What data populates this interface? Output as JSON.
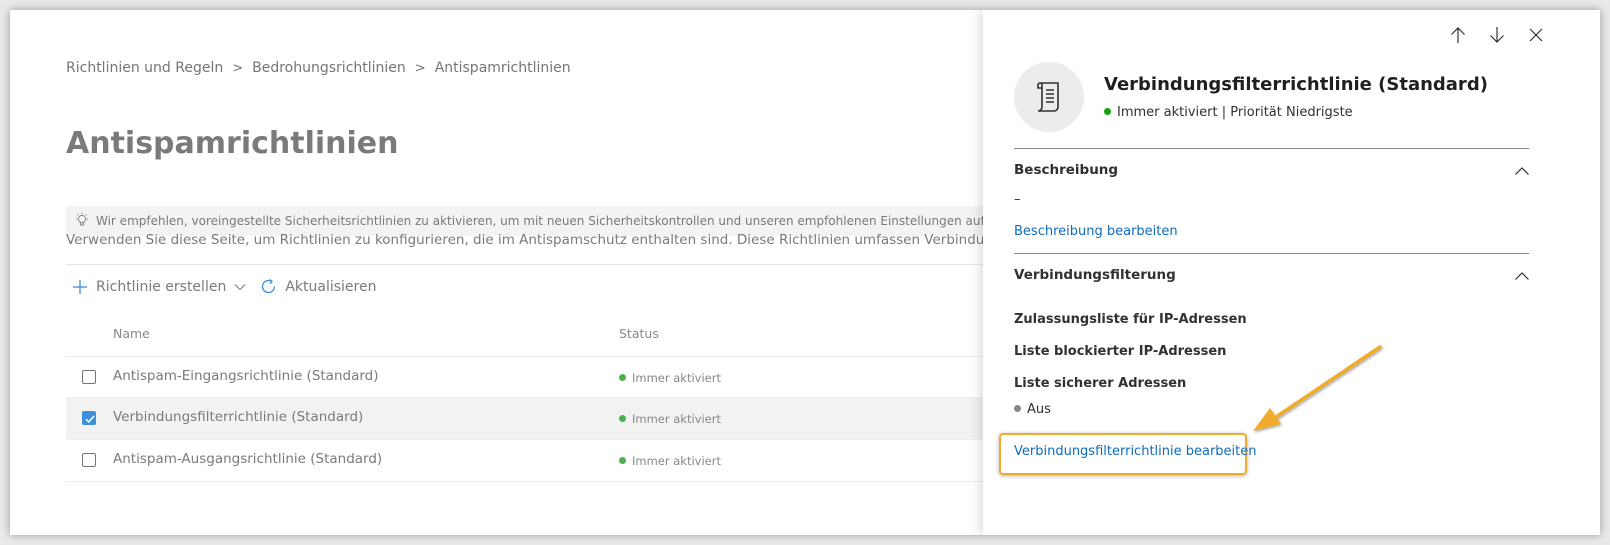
{
  "breadcrumb": {
    "items": [
      "Richtlinien und Regeln",
      "Bedrohungsrichtlinien",
      "Antispamrichtlinien"
    ],
    "separator": ">"
  },
  "page": {
    "title": "Antispamrichtlinien",
    "recommendation": "Wir empfehlen, voreingestellte Sicherheitsrichtlinien zu aktivieren, um mit neuen Sicherheitskontrollen und unseren empfohlenen Einstellungen auf dem Laufenden zu bleiben",
    "description": "Verwenden Sie diese Seite, um Richtlinien zu konfigurieren, die im Antispamschutz enthalten sind. Diese Richtlinien umfassen Verbindungsfilterung, Spamf"
  },
  "toolbar": {
    "create_label": "Richtlinie erstellen",
    "refresh_label": "Aktualisieren"
  },
  "table": {
    "columns": {
      "name": "Name",
      "status": "Status"
    },
    "rows": [
      {
        "name": "Antispam-Eingangsrichtlinie (Standard)",
        "status": "Immer aktiviert",
        "selected": false
      },
      {
        "name": "Verbindungsfilterrichtlinie (Standard)",
        "status": "Immer aktiviert",
        "selected": true
      },
      {
        "name": "Antispam-Ausgangsrichtlinie (Standard)",
        "status": "Immer aktiviert",
        "selected": false
      }
    ]
  },
  "panel": {
    "title": "Verbindungsfilterrichtlinie (Standard)",
    "subtitle": "Immer aktiviert | Priorität Niedrigste",
    "sections": {
      "description": {
        "header": "Beschreibung",
        "value": "–",
        "edit_link": "Beschreibung bearbeiten"
      },
      "connection_filter": {
        "header": "Verbindungsfilterung",
        "fields": [
          "Zulassungsliste für IP-Adressen",
          "Liste blockierter IP-Adressen",
          "Liste sicherer Adressen"
        ],
        "safe_list_value": "Aus",
        "edit_link": "Verbindungsfilterrichtlinie bearbeiten"
      }
    }
  },
  "colors": {
    "status_green": "#4caf50",
    "status_grey": "#8a8886",
    "link_blue": "#0f6cbd",
    "highlight_orange": "#f0ab2a",
    "checkbox_blue": "#3c8fd8"
  },
  "icons": {
    "recommendation": "lightbulb-icon",
    "create": "plus-icon",
    "create_dropdown": "chevron-down-icon",
    "refresh": "refresh-icon",
    "panel_up": "arrow-up-icon",
    "panel_down": "arrow-down-icon",
    "panel_close": "close-icon",
    "panel_avatar": "scroll-document-icon",
    "section_toggle": "chevron-up-icon"
  }
}
